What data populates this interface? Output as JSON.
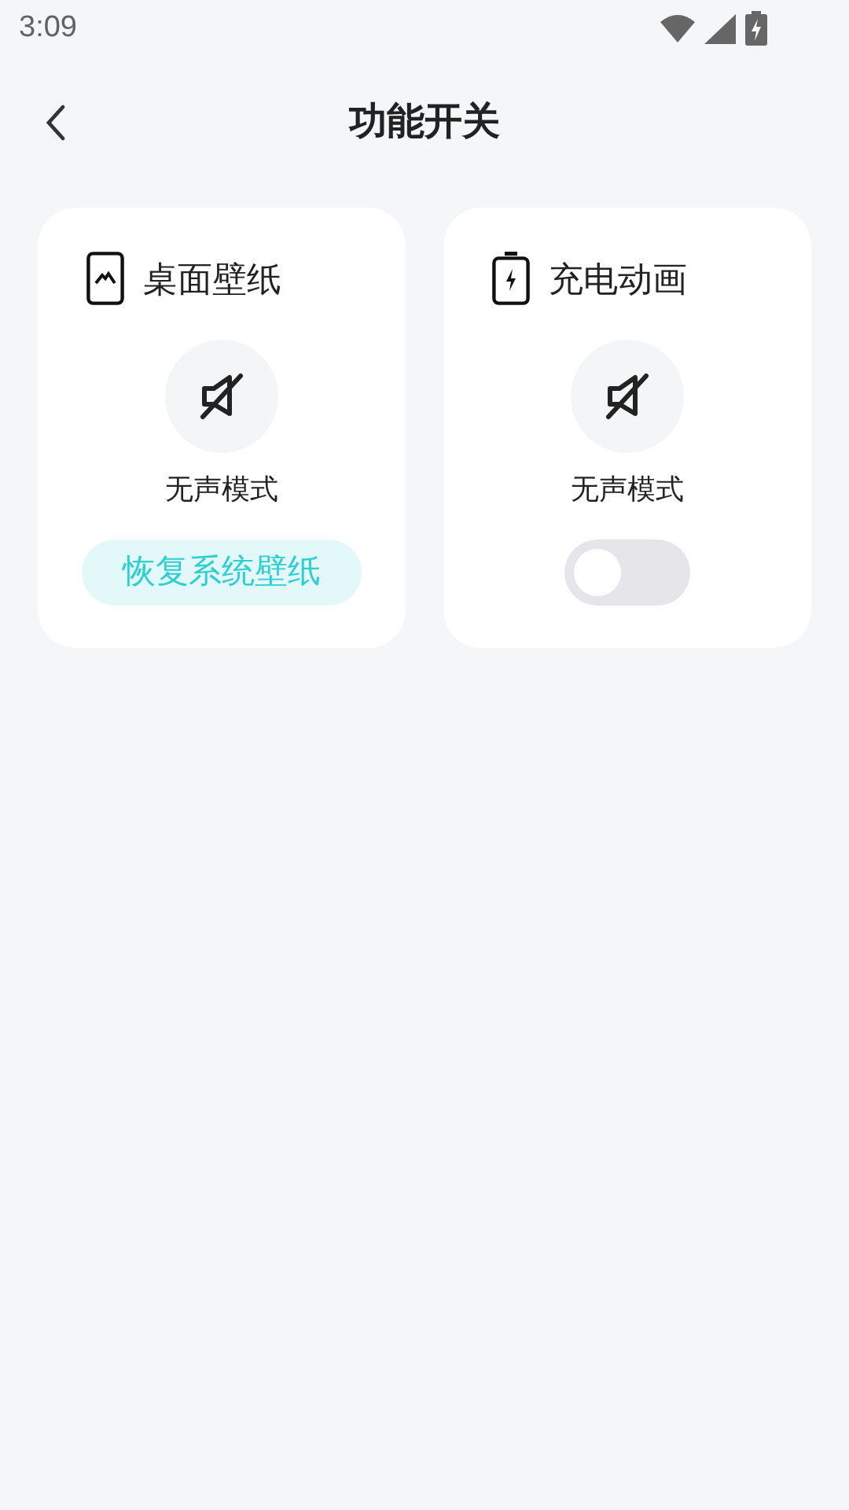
{
  "status_bar": {
    "time": "3:09"
  },
  "header": {
    "title": "功能开关"
  },
  "cards": [
    {
      "kind": "button",
      "title": "桌面壁纸",
      "mode_label": "无声模式",
      "button_label": "恢复系统壁纸"
    },
    {
      "kind": "switch",
      "title": "充电动画",
      "mode_label": "无声模式",
      "on": false
    }
  ]
}
